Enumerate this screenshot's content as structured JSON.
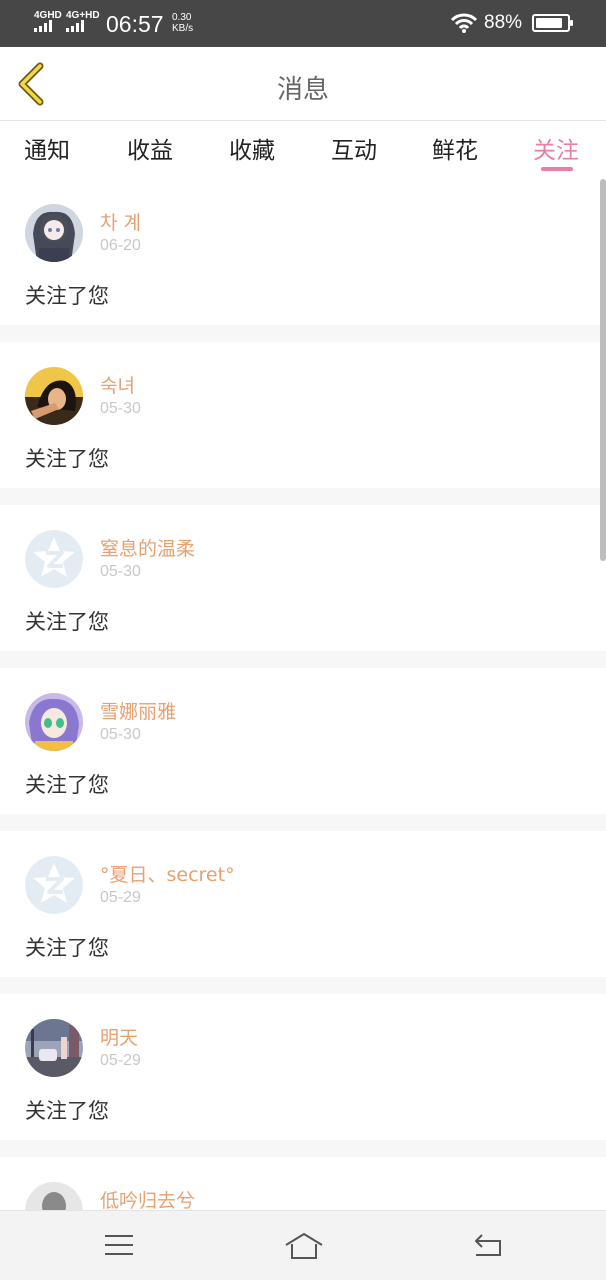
{
  "status_bar": {
    "network1": "4GHD",
    "network2": "4G+HD",
    "time": "06:57",
    "speed_value": "0.30",
    "speed_unit": "KB/s",
    "battery_percent": "88%",
    "battery_level": 0.88,
    "wifi_icon": "wifi-icon"
  },
  "header": {
    "title": "消息",
    "back_icon": "chevron-left-icon"
  },
  "tabs": [
    {
      "label": "通知"
    },
    {
      "label": "收益"
    },
    {
      "label": "收藏"
    },
    {
      "label": "互动"
    },
    {
      "label": "鲜花"
    },
    {
      "label": "关注",
      "active": true
    }
  ],
  "colors": {
    "accent": "#e97fa6",
    "username": "#e8a070",
    "date": "#c8c8c8"
  },
  "messages": [
    {
      "name": "차 계",
      "date": "06-20",
      "text": "关注了您",
      "avatar": "anime-girl-avatar"
    },
    {
      "name": "숙녀",
      "date": "05-30",
      "text": "关注了您",
      "avatar": "photo-avatar"
    },
    {
      "name": "窒息的温柔",
      "date": "05-30",
      "text": "关注了您",
      "avatar": "default-z-avatar"
    },
    {
      "name": "雪娜丽雅",
      "date": "05-30",
      "text": "关注了您",
      "avatar": "anime-character-avatar"
    },
    {
      "name": "°夏日、secret°",
      "date": "05-29",
      "text": "关注了您",
      "avatar": "default-z-avatar"
    },
    {
      "name": "明天",
      "date": "05-29",
      "text": "关注了您",
      "avatar": "street-photo-avatar"
    },
    {
      "name": "低吟归去兮",
      "date": "",
      "text": "",
      "avatar": "grey-avatar"
    }
  ],
  "navbar": {
    "menu_icon": "menu-icon",
    "home_icon": "home-icon",
    "back_icon": "return-icon"
  }
}
